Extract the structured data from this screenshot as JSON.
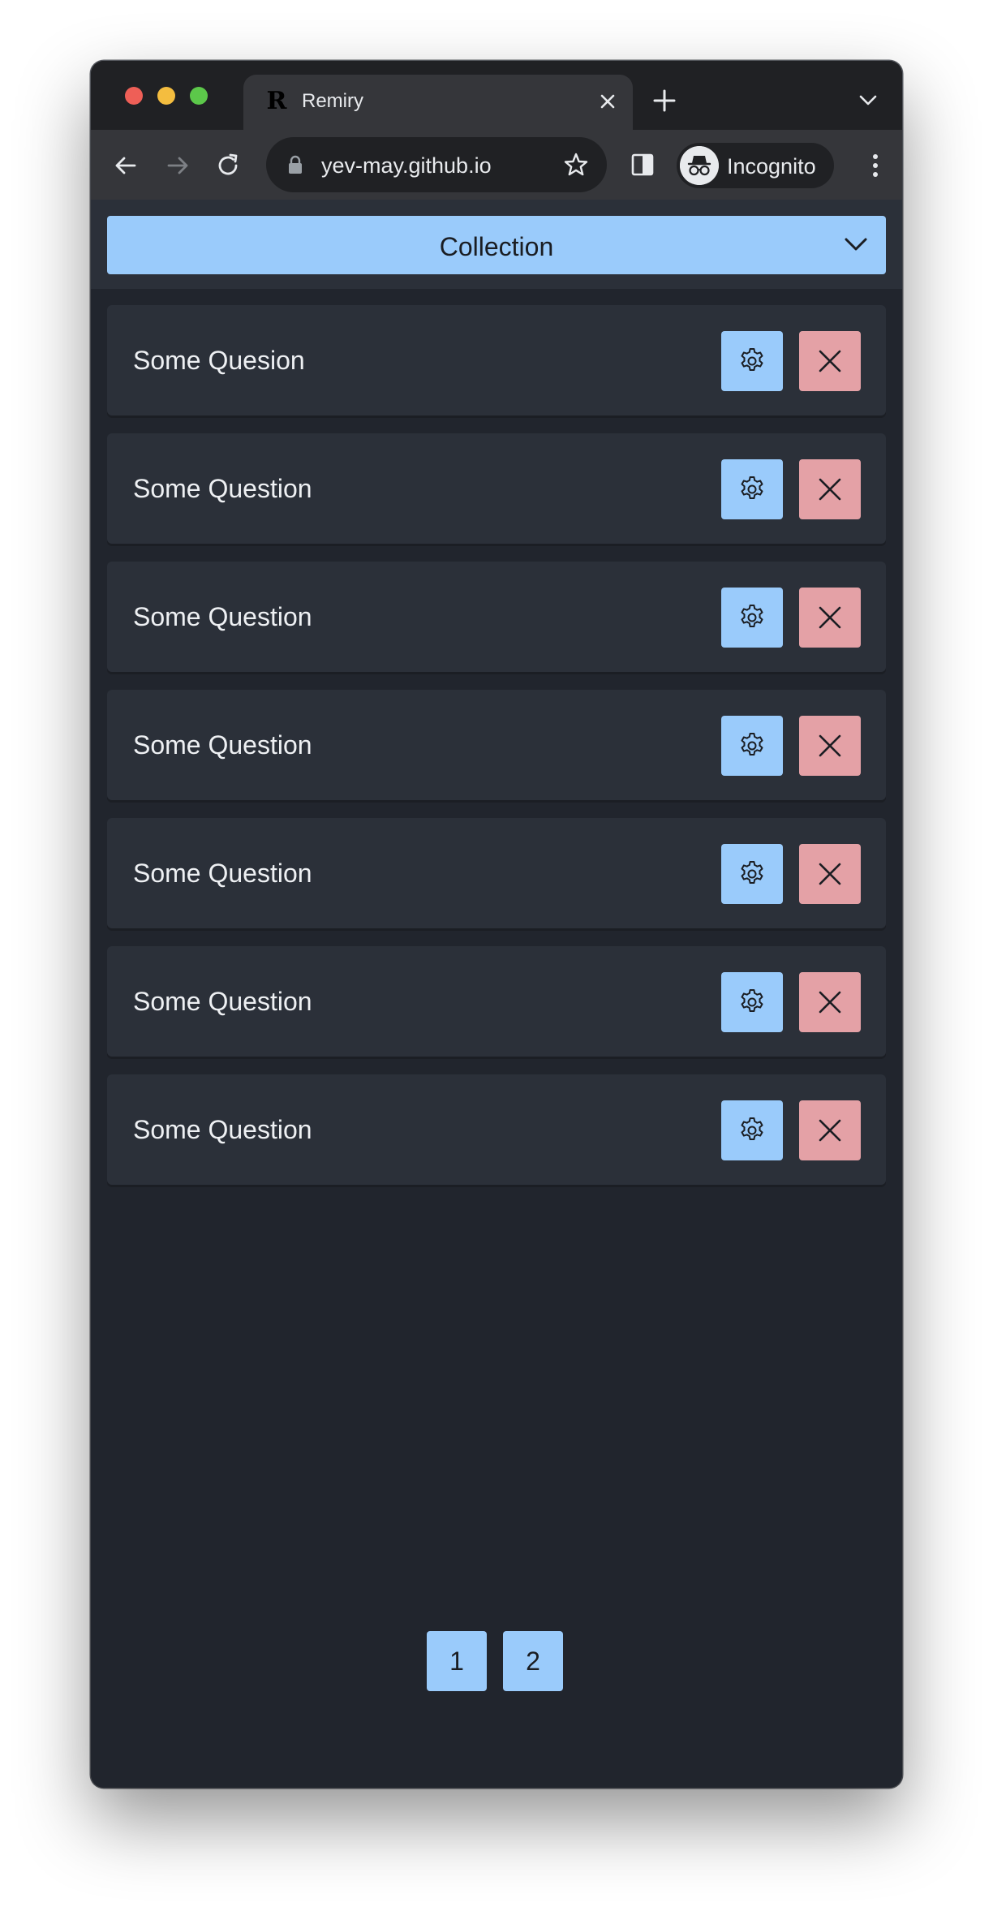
{
  "browser": {
    "tab": {
      "favicon": "R",
      "title": "Remiry"
    },
    "url": "yev-may.github.io",
    "profile_label": "Incognito"
  },
  "app": {
    "collection_select": {
      "label": "Collection"
    },
    "questions": [
      {
        "label": "Some Quesion"
      },
      {
        "label": "Some Question"
      },
      {
        "label": "Some Question"
      },
      {
        "label": "Some Question"
      },
      {
        "label": "Some Question"
      },
      {
        "label": "Some Question"
      },
      {
        "label": "Some Question"
      }
    ],
    "pagination": {
      "pages": [
        "1",
        "2"
      ]
    }
  },
  "colors": {
    "accent_blue": "#9acbfb",
    "delete_pink": "#e4a1a6",
    "page_bg": "#21252d",
    "card_bg": "#2b3039"
  },
  "icons": [
    "back-icon",
    "forward-icon",
    "reload-icon",
    "lock-icon",
    "star-icon",
    "side-panel-icon",
    "incognito-icon",
    "more-icon",
    "chevron-down-icon",
    "gear-icon",
    "close-icon"
  ]
}
